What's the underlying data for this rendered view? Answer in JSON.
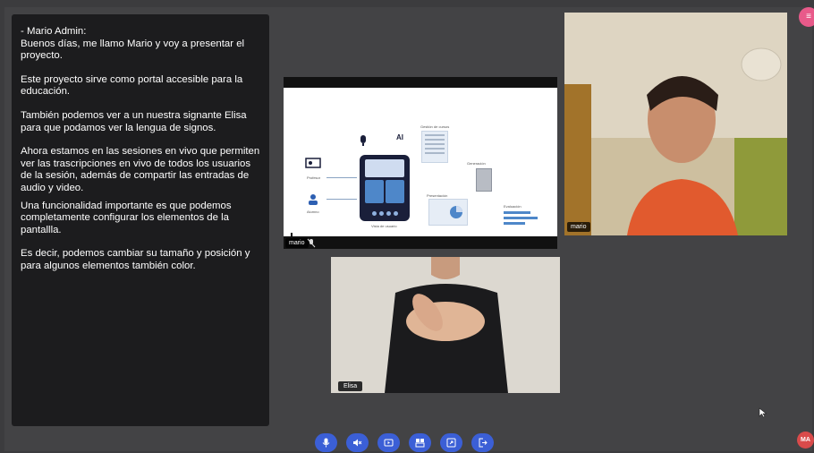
{
  "transcript": {
    "paragraphs": [
      "- Mario Admin:\nBuenos días, me llamo Mario y voy a presentar el proyecto.",
      "Este proyecto sirve como portal accesible para la educación.",
      "También podemos ver a un nuestra signante Elisa para que podamos ver la lengua de signos.",
      "Ahora estamos en las sesiones en vivo que permiten ver las trascripciones en vivo de todos los usuarios de la sesión, además de compartir las entradas de audio y video.",
      "Una funcionalidad importante es que podemos completamente configurar los elementos de la pantallla.",
      "Es decir, podemos cambiar su tamaño y posición y para algunos elementos también color."
    ]
  },
  "presentation": {
    "presenter_tag": "mario",
    "diagram_labels": {
      "profesor": "Profesor",
      "alumno": "Alumno",
      "tablet": "Vista de usuario",
      "top": "Gestión de cursos",
      "right": "Generación",
      "bottom": "Presentación",
      "far_right": "Evaluación",
      "ai": "AI"
    }
  },
  "participants": {
    "mario": {
      "name": "mario"
    },
    "elisa": {
      "name": "Elisa"
    }
  },
  "menu_button": {
    "icon": "menu-icon",
    "symbol": "≡"
  },
  "toolbar": {
    "buttons": [
      {
        "name": "microphone-button",
        "icon": "mic-icon"
      },
      {
        "name": "audio-button",
        "icon": "speaker-muted-icon"
      },
      {
        "name": "video-button",
        "icon": "video-icon"
      },
      {
        "name": "layout-button",
        "icon": "layout-icon"
      },
      {
        "name": "screen-share-button",
        "icon": "screen-share-icon"
      },
      {
        "name": "leave-button",
        "icon": "exit-icon"
      }
    ]
  },
  "user_avatar": {
    "initials": "MA"
  },
  "colors": {
    "accent": "#3b5fd6",
    "menu": "#e85a8a",
    "avatar": "#d94b4b",
    "panel": "#1c1c1e",
    "background": "#434345"
  }
}
